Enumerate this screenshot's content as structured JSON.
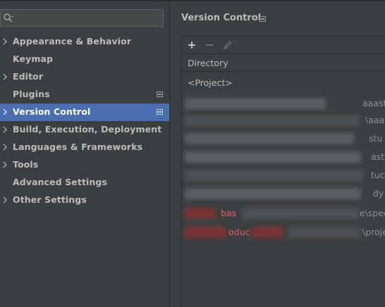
{
  "search": {
    "placeholder": ""
  },
  "sidebar": {
    "items": [
      {
        "label": "Appearance & Behavior",
        "expandable": true
      },
      {
        "label": "Keymap",
        "expandable": false
      },
      {
        "label": "Editor",
        "expandable": true
      },
      {
        "label": "Plugins",
        "expandable": false,
        "has_page_icon": true
      },
      {
        "label": "Version Control",
        "expandable": true,
        "has_page_icon": true,
        "selected": true
      },
      {
        "label": "Build, Execution, Deployment",
        "expandable": true
      },
      {
        "label": "Languages & Frameworks",
        "expandable": true
      },
      {
        "label": "Tools",
        "expandable": true
      },
      {
        "label": "Advanced Settings",
        "expandable": false
      },
      {
        "label": "Other Settings",
        "expandable": true
      }
    ]
  },
  "content": {
    "title": "Version Control",
    "toolbar": {
      "add_icon": "plus-icon",
      "remove_icon": "minus-icon",
      "edit_icon": "pencil-icon"
    },
    "table": {
      "columns": [
        "Directory"
      ],
      "rows": [
        {
          "directory": "<Project>",
          "color": "default"
        },
        {
          "visible_fragment": "aaast",
          "color": "default"
        },
        {
          "visible_fragment": "\\aaa",
          "color": "default"
        },
        {
          "visible_fragment": "stu",
          "color": "default"
        },
        {
          "visible_fragment": "ast",
          "color": "default"
        },
        {
          "visible_fragment": "tuc",
          "color": "default"
        },
        {
          "visible_fragment": "dy",
          "color": "default"
        },
        {
          "visible_fragment_left": "bas",
          "visible_fragment": "e\\spee",
          "color": "red"
        },
        {
          "visible_fragment_left": "oduc",
          "visible_fragment": "\\proje",
          "color": "red"
        }
      ]
    }
  },
  "colors": {
    "background": "#3c3f41",
    "selection": "#4b6eaf",
    "text": "#bbbbbb",
    "unversioned_red": "#e05f5f",
    "border": "#2b2d2e"
  }
}
